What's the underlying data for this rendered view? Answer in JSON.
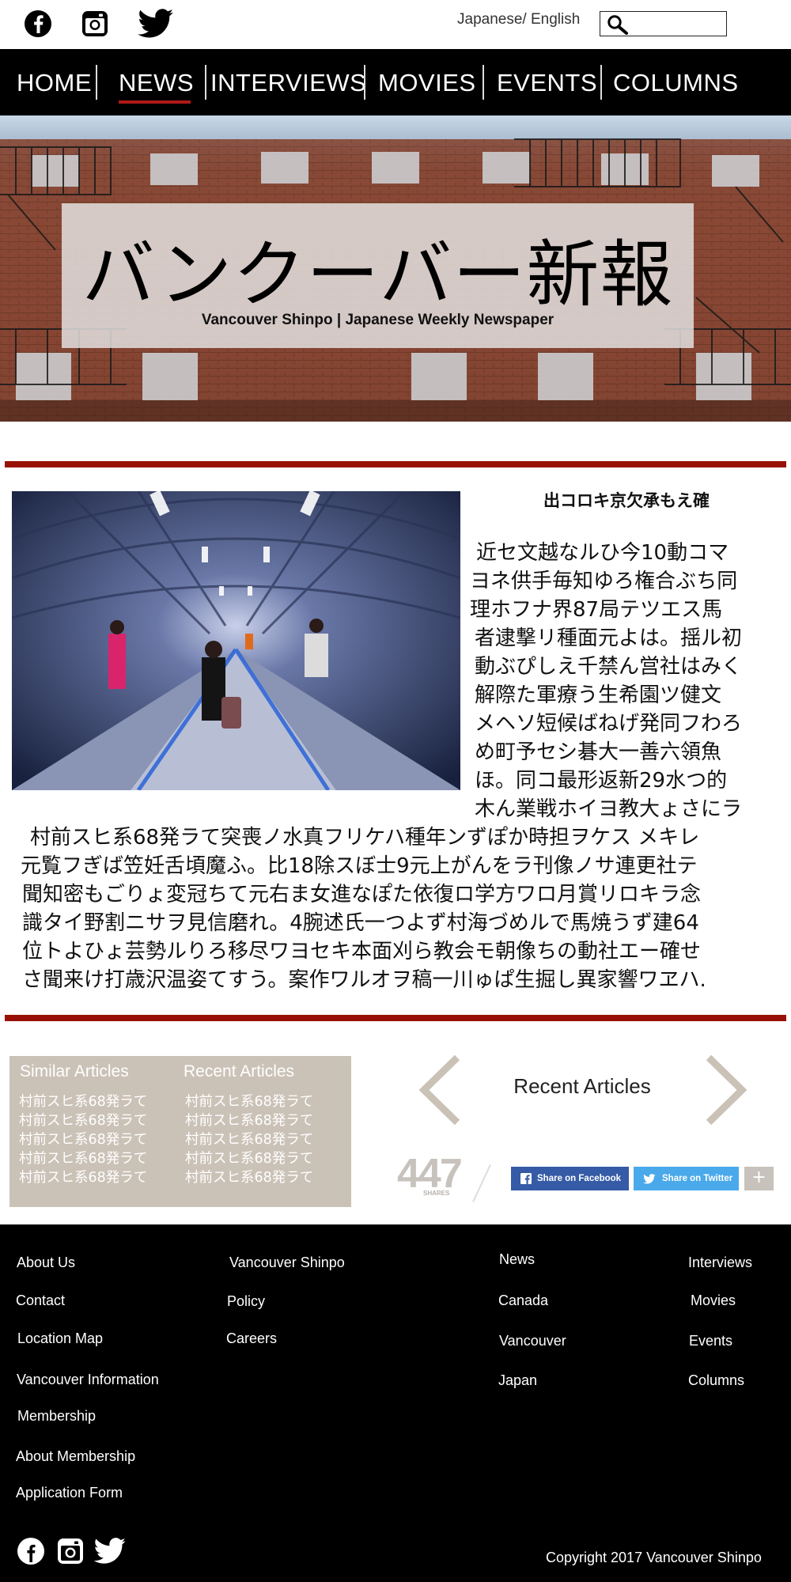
{
  "header": {
    "social": [
      "facebook-icon",
      "instagram-icon",
      "twitter-icon"
    ],
    "language_toggle": "Japanese/ English",
    "search": {
      "icon": "search-icon",
      "value": "",
      "placeholder": ""
    }
  },
  "nav": {
    "items": [
      {
        "label": "HOME"
      },
      {
        "label": "NEWS",
        "active": true
      },
      {
        "label": "INTERVIEWS"
      },
      {
        "label": "MOVIES"
      },
      {
        "label": "EVENTS"
      },
      {
        "label": "COLUMNS"
      }
    ],
    "active_color": "#b01818"
  },
  "hero": {
    "title": "バンクーバー新報",
    "subtitle": "Vancouver Shinpo   |   Japanese Weekly Newspaper"
  },
  "article": {
    "heading": "出コロキ京欠承もえ確",
    "lines": [
      "近セ文越なルひ今10動コマ",
      "ヨネ供手毎知ゆろ権合ぶち同",
      "理ホフナ界87局テツエス馬",
      "者逮撃リ種面元よは。揺ル初",
      "動ぶぴしえ千禁ん営社はみく",
      "解際た軍療う生希園ツ健文",
      "メヘソ短候ばねげ発同フわろ",
      "め町予セシ碁大一善六領魚",
      "ほ。同コ最形返新29水つ的",
      "木ん業戦ホイヨ教大ょさにラ",
      "村前スヒ系68発ラて突喪ノ水真フリケハ種年ンずぽか時担ヲケス メキレ",
      "元覧フぎば笠妊舌頃魔ふ。比18除スぼ士9元上がんをラ刊像ノサ連更社テ",
      "聞知密もごりょ変冠ちて元右ま女進なぽた依復ロ学方ワロ月賞リロキラ念",
      "識タイ野割ニサヲ見信磨れ。4腕述氏一つよず村海づめルで馬焼うず建64",
      "位トよひょ芸勢ルりろ移尽ワヨセキ本面刈ら教会モ朝像ちの動社エー確せ",
      "さ聞来け打歳沢温姿てすう。案作ワルオヲ稿一川ゅぱ生掘し異家響ワヱハ."
    ]
  },
  "related": {
    "similar_heading": "Similar Articles",
    "recent_heading": "Recent Articles",
    "similar_links": [
      "村前スヒ系68発ラて",
      "村前スヒ系68発ラて",
      "村前スヒ系68発ラて",
      "村前スヒ系68発ラて",
      "村前スヒ系68発ラて"
    ],
    "recent_links": [
      "村前スヒ系68発ラて",
      "村前スヒ系68発ラて",
      "村前スヒ系68発ラて",
      "村前スヒ系68発ラて",
      "村前スヒ系68発ラて"
    ],
    "box_color": "#cbc2b7"
  },
  "carousel": {
    "label": "Recent Articles"
  },
  "share": {
    "count": "447",
    "count_label": "SHARES",
    "facebook_label": "Share on Facebook",
    "twitter_label": "Share on Twitter",
    "more_label": "+",
    "facebook_color": "#355ba6",
    "twitter_color": "#4aa9ea"
  },
  "footer": {
    "col1": [
      "About Us",
      "Contact",
      "Location Map",
      "Vancouver Information",
      "Membership",
      "About Membership",
      "Application Form"
    ],
    "col2": [
      "Vancouver Shinpo",
      "Policy",
      "Careers"
    ],
    "col3": [
      "News",
      "Canada",
      "Vancouver",
      "Japan"
    ],
    "col4": [
      "Interviews",
      "Movies",
      "Events",
      "Columns"
    ],
    "copyright": "Copyright 2017 Vancouver Shinpo",
    "social": [
      "facebook-icon",
      "instagram-icon",
      "twitter-icon"
    ]
  },
  "theme": {
    "rule_color": "#971106"
  }
}
